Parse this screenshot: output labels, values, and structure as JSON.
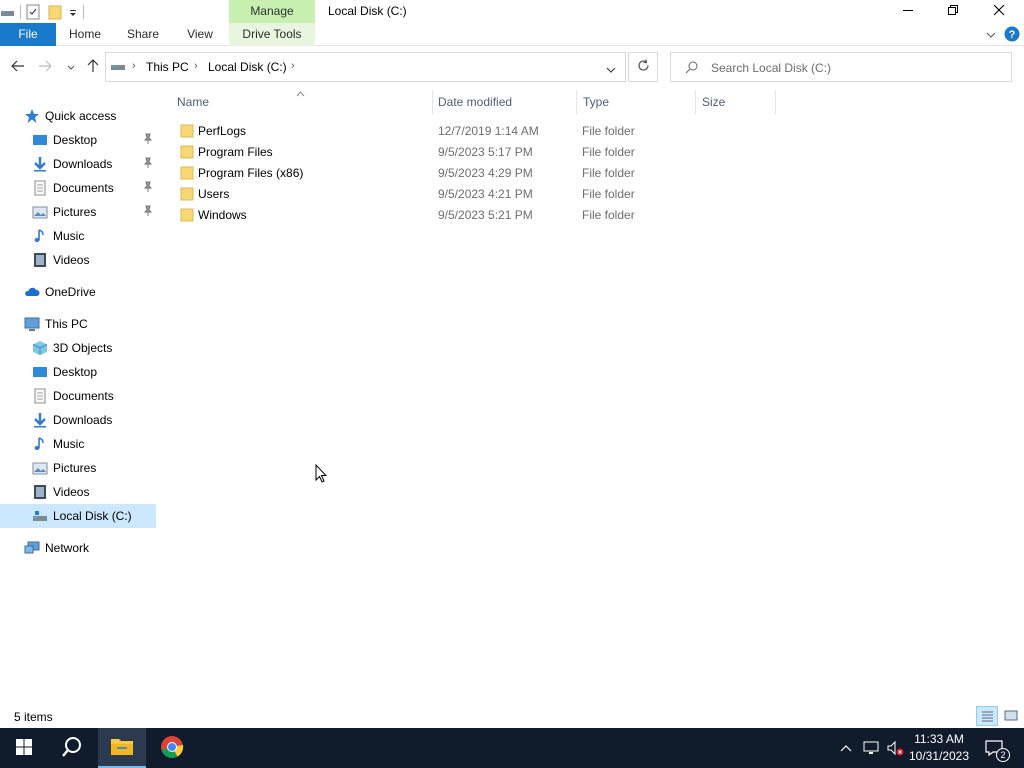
{
  "window": {
    "title": "Local Disk (C:)",
    "manage_tab": "Manage",
    "controls": {
      "minimize": "minimize-icon",
      "restore": "restore-icon",
      "close": "close-icon"
    }
  },
  "ribbon": {
    "tabs": [
      {
        "label": "File"
      },
      {
        "label": "Home"
      },
      {
        "label": "Share"
      },
      {
        "label": "View"
      },
      {
        "label": "Drive Tools"
      }
    ]
  },
  "address": {
    "breadcrumb": [
      "This PC",
      "Local Disk (C:)"
    ]
  },
  "search": {
    "placeholder": "Search Local Disk (C:)"
  },
  "nav": {
    "quick_access": "Quick access",
    "quick_items": [
      {
        "label": "Desktop",
        "pinned": true
      },
      {
        "label": "Downloads",
        "pinned": true
      },
      {
        "label": "Documents",
        "pinned": true
      },
      {
        "label": "Pictures",
        "pinned": true
      },
      {
        "label": "Music",
        "pinned": false
      },
      {
        "label": "Videos",
        "pinned": false
      }
    ],
    "onedrive": "OneDrive",
    "this_pc": "This PC",
    "pc_items": [
      {
        "label": "3D Objects"
      },
      {
        "label": "Desktop"
      },
      {
        "label": "Documents"
      },
      {
        "label": "Downloads"
      },
      {
        "label": "Music"
      },
      {
        "label": "Pictures"
      },
      {
        "label": "Videos"
      },
      {
        "label": "Local Disk (C:)",
        "selected": true
      }
    ],
    "network": "Network"
  },
  "columns": {
    "name": "Name",
    "date": "Date modified",
    "type": "Type",
    "size": "Size"
  },
  "files": [
    {
      "name": "PerfLogs",
      "date": "12/7/2019 1:14 AM",
      "type": "File folder"
    },
    {
      "name": "Program Files",
      "date": "9/5/2023 5:17 PM",
      "type": "File folder"
    },
    {
      "name": "Program Files (x86)",
      "date": "9/5/2023 4:29 PM",
      "type": "File folder"
    },
    {
      "name": "Users",
      "date": "9/5/2023 4:21 PM",
      "type": "File folder"
    },
    {
      "name": "Windows",
      "date": "9/5/2023 5:21 PM",
      "type": "File folder"
    }
  ],
  "status": {
    "items": "5 items"
  },
  "taskbar": {
    "time": "11:33 AM",
    "date": "10/31/2023",
    "notifications": "2"
  },
  "colors": {
    "accent": "#1979ca",
    "manage": "#c6efb0",
    "selected": "#cce8ff",
    "folder": "#f8d775",
    "taskbar": "#101b2b"
  }
}
